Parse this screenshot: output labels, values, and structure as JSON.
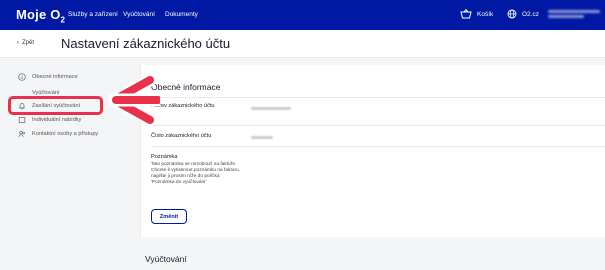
{
  "topbar": {
    "brand": "Moje O",
    "brand_sub": "2",
    "nav": [
      "Služby a zařízení",
      "Vyúčtování",
      "Dokumenty"
    ],
    "cart_label": "Košík",
    "site_label": "O2.cz"
  },
  "header": {
    "back_label": "Zpět",
    "title": "Nastavení zákaznického účtu"
  },
  "sidebar": {
    "items": [
      {
        "label": "Obecné informace",
        "icon": "info-icon"
      },
      {
        "label": "Vyúčtování",
        "icon": "bill-icon"
      },
      {
        "label": "Zasílání vyúčtování",
        "icon": "bell-icon"
      },
      {
        "label": "Individuální nabídky",
        "icon": "offer-icon"
      },
      {
        "label": "Kontaktní osoby a přístupy",
        "icon": "people-icon"
      }
    ]
  },
  "main": {
    "section_title": "Obecné informace",
    "fields": [
      {
        "label": "Název zákaznického účtu"
      },
      {
        "label": "Číslo zákaznického účtu"
      },
      {
        "label": "Poznámka"
      }
    ],
    "note_text": "Tato poznámka se nezobrazí na faktuře. Chcete-li vytisknout poznámku na fakturu, napište ji prosím níže do políčka 'Poznámka do vyúčtování'",
    "edit_button": "Změnit",
    "section2_title": "Vyúčtování"
  },
  "colors": {
    "brand": "#0019a5",
    "highlight": "#e8314a"
  }
}
